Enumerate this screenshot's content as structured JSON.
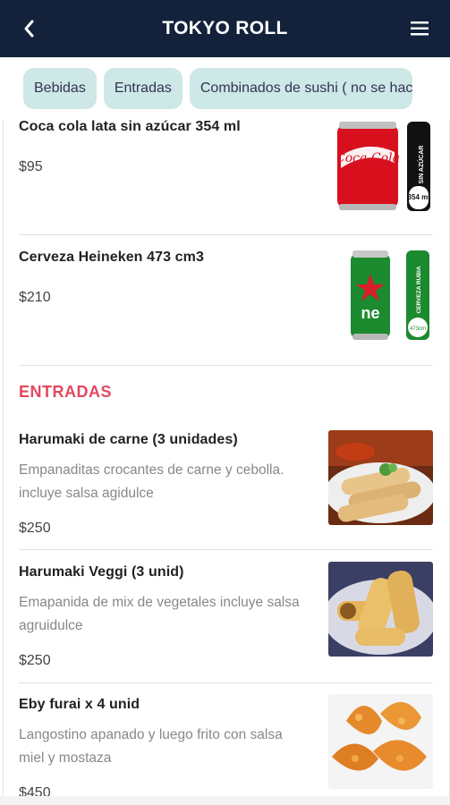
{
  "header": {
    "title": "TOKYO ROLL",
    "back_icon": "chevron-left-icon",
    "menu_icon": "hamburger-menu-icon"
  },
  "categories": [
    "Bebidas",
    "Entradas",
    "Combinados de sushi ( no se hac"
  ],
  "bebidas": [
    {
      "name": "Coca cola lata sin azúcar 354 ml",
      "price": "$95",
      "image": "coca-cola-zero-can",
      "can_side_text": "SIN AZÚCAR",
      "can_volume": "354 ml"
    },
    {
      "name": "Cerveza Heineken 473 cm3",
      "price": "$210",
      "image": "heineken-can",
      "can_side_text": "CERVEZA RUBIA",
      "can_volume": "473cm"
    }
  ],
  "entradas_title": "ENTRADAS",
  "entradas": [
    {
      "name": "Harumaki de carne (3 unidades)",
      "desc_1": "Empanaditas crocantes de carne y cebolla.",
      "desc_2": "incluye salsa agidulce",
      "price": "$250",
      "image": "spring-rolls-meat"
    },
    {
      "name": "Harumaki Veggi (3 unid)",
      "desc_1": "Emapanida de mix de vegetales incluye salsa",
      "desc_2": "agruidulce",
      "price": "$250",
      "image": "spring-rolls-veggie"
    },
    {
      "name": "Eby furai x 4 unid",
      "desc_1": "Langostino apanado y luego frito con salsa",
      "desc_2": "miel y mostaza",
      "price": "$450",
      "image": "fried-shrimp"
    }
  ],
  "colors": {
    "header_bg": "#13223a",
    "chip_bg": "#cde8e6",
    "section_title": "#e3485e"
  }
}
